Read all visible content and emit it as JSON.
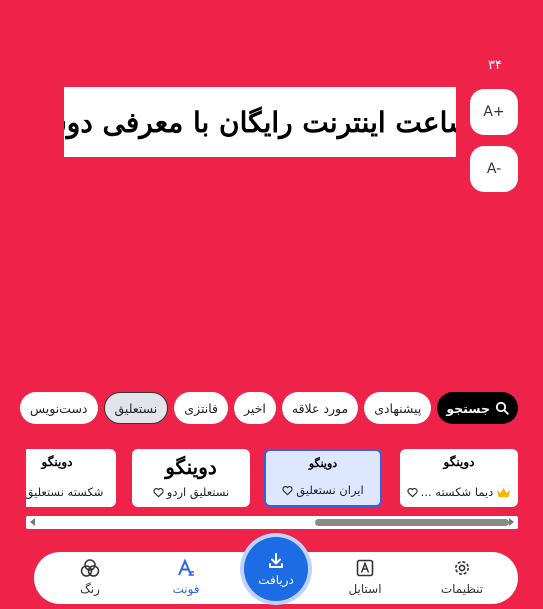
{
  "size": {
    "value": "۳۴",
    "increase_label": "A+",
    "decrease_label": "A-"
  },
  "preview": {
    "text": "یک ساعت اینترنت رایگان با معرفی دوستان"
  },
  "filters": {
    "search_label": "جستجو",
    "chips": [
      "پیشنهادی",
      "مورد علاقه",
      "اخیر",
      "فانتزی",
      "نستعلیق",
      "دست‌نویس"
    ],
    "active_chip": "نستعلیق"
  },
  "fonts": [
    {
      "name": "دیما شکسته ...",
      "sample": "دوینگو",
      "premium": true,
      "selected": false
    },
    {
      "name": "ایران نستعلیق",
      "sample": "دوینگو",
      "premium": false,
      "selected": true
    },
    {
      "name": "نستعلیق اردو",
      "sample": "دوینگو",
      "premium": false,
      "selected": false
    },
    {
      "name": "شکسته نستعلیق",
      "sample": "دوینگو",
      "premium": false,
      "selected": false
    }
  ],
  "nav": {
    "settings": "تنظیمات",
    "style": "استایل",
    "download": "دریافت",
    "font": "فونت",
    "color": "رنگ"
  },
  "colors": {
    "background": "#ef2349",
    "accent": "#1e6be6",
    "premium": "#f2b900"
  }
}
